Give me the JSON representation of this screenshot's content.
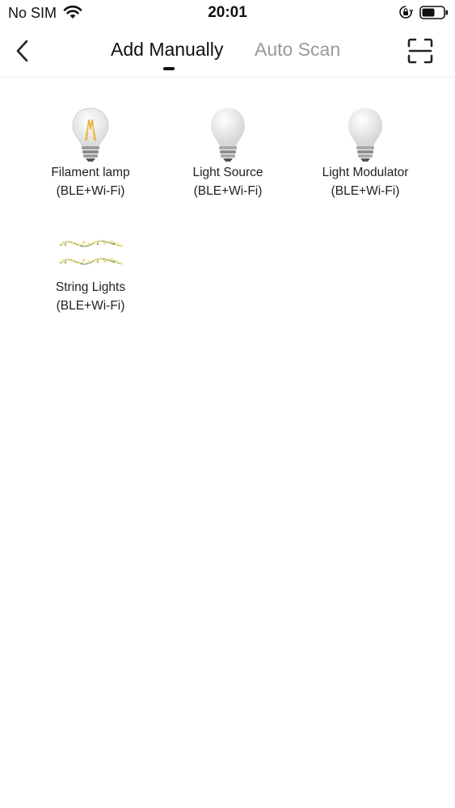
{
  "status_bar": {
    "carrier": "No SIM",
    "time": "20:01"
  },
  "nav": {
    "tabs": [
      {
        "label": "Add Manually",
        "active": true
      },
      {
        "label": "Auto Scan",
        "active": false
      }
    ]
  },
  "devices": [
    {
      "name": "Filament lamp",
      "protocol": "(BLE+Wi-Fi)",
      "icon": "filament-bulb-icon"
    },
    {
      "name": "Light Source",
      "protocol": "(BLE+Wi-Fi)",
      "icon": "bulb-icon"
    },
    {
      "name": "Light Modulator",
      "protocol": "(BLE+Wi-Fi)",
      "icon": "bulb-icon"
    },
    {
      "name": "String Lights",
      "protocol": "(BLE+Wi-Fi)",
      "icon": "string-lights-icon"
    }
  ],
  "colors": {
    "active_tab": "#111111",
    "inactive_tab": "#9a9a9a",
    "filament": "#e8b43c"
  }
}
